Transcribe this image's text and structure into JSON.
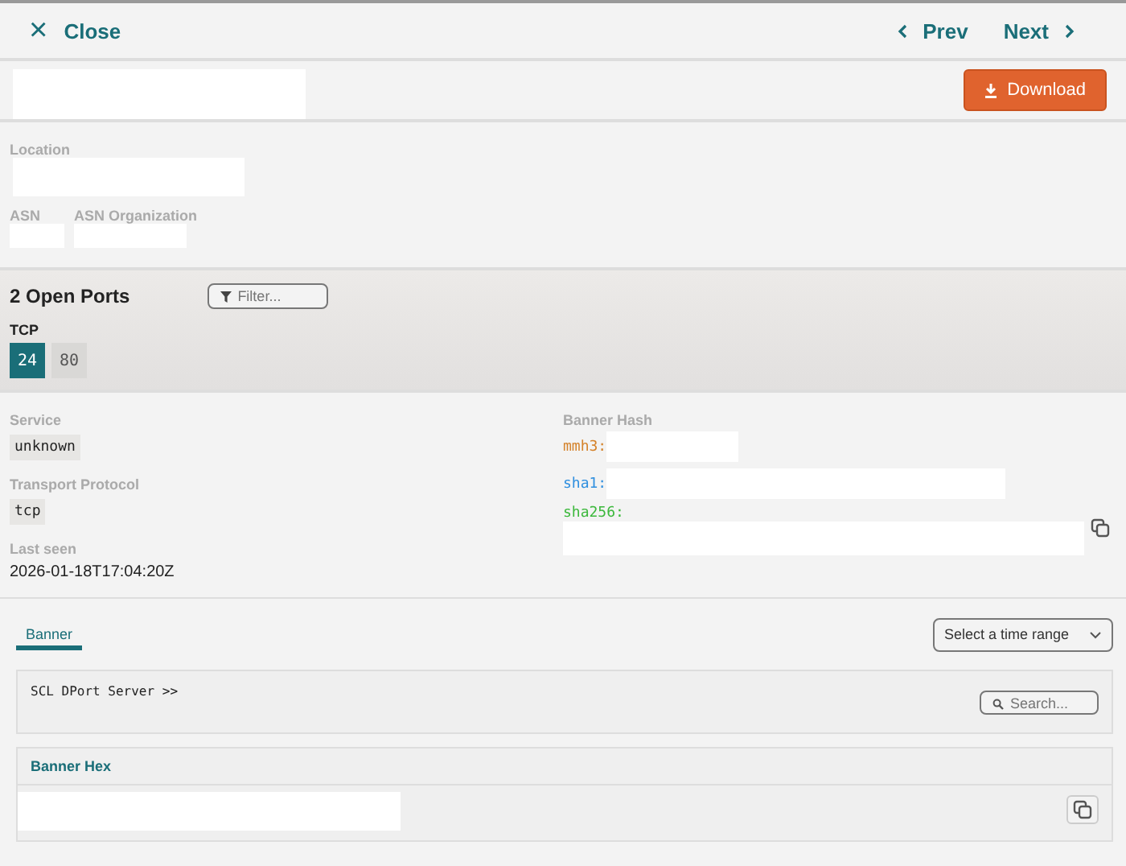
{
  "top_bar": {
    "close": {
      "icon": "×",
      "label": "Close"
    },
    "prev": "Prev",
    "next": "Next"
  },
  "header": {
    "download": "Download"
  },
  "info": {
    "location_label": "Location",
    "asn_label": "ASN",
    "asn_org_label": "ASN Organization"
  },
  "ports": {
    "title": "2 Open Ports",
    "filter": {
      "placeholder": "Filter..."
    },
    "protocol": "TCP",
    "items": [
      {
        "label": "24",
        "selected": true
      },
      {
        "label": "80",
        "selected": false
      }
    ]
  },
  "details": {
    "service_label": "Service",
    "service": "unknown",
    "transport_label": "Transport Protocol",
    "transport": "tcp",
    "last_seen_label": "Last seen",
    "last_seen": "2026-01-18T17:04:20Z",
    "banner_hash_label": "Banner Hash",
    "hashes": [
      {
        "label": "mmh3:",
        "color": "#d4822a"
      },
      {
        "label": "sha1:",
        "color": "#2f8fdf"
      },
      {
        "label": "sha256:",
        "color": "#3cb83c"
      }
    ]
  },
  "banner": {
    "tabs": [
      {
        "label": "Banner",
        "selected": true
      }
    ],
    "time_range": "Select a time range",
    "text": "SCL DPort Server >>",
    "search": {
      "placeholder": "Search..."
    },
    "hex_title": "Banner Hex"
  }
}
